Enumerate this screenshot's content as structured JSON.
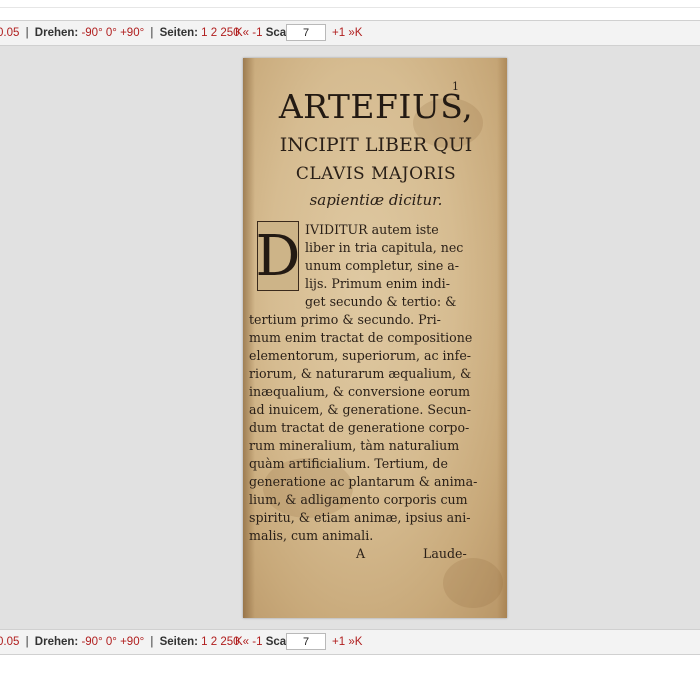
{
  "toolbar": {
    "zoom_value": "0.05",
    "sep": "|",
    "rotate_label": "Drehen:",
    "rotate_options": [
      "-90°",
      "0°",
      "+90°"
    ],
    "pages_label": "Seiten:",
    "pages_options": [
      "1",
      "2",
      "250"
    ],
    "first_icon": "first-page-icon",
    "first_glyph": "K«",
    "prev_label": "-1",
    "scan_label": "Scan",
    "scan_value": "7",
    "next_label": "+1",
    "last_icon": "last-page-icon",
    "last_glyph": "»K"
  },
  "page": {
    "page_number": "1",
    "title_line1": "ARTEFIUS,",
    "title_line2": "INCIPIT LIBER QUI",
    "title_line3": "CLAVIS MAJORIS",
    "title_line4": "sapientiæ dicitur.",
    "dropcap": "D",
    "body_lines": [
      "IVIDITUR autem iste",
      "liber in tria capitula, nec",
      "unum completur, sine a-",
      "lijs.  Primum enim indi-",
      "get secundo & tertio: &",
      "tertium primo & secundo.  Pri-",
      "mum enim tractat de compositione",
      "elementorum, superiorum, ac infe-",
      "riorum, & naturarum æqualium, &",
      "inæqualium, & conversione eorum",
      "ad inuicem, & generatione. Secun-",
      "dum tractat de generatione corpo-",
      "rum mineralium, tàm naturalium",
      "quàm artificialium.  Tertium, de",
      "generatione ac plantarum & anima-",
      "lium, & adligamento corporis cum",
      "spiritu, & etiam animæ, ipsius ani-",
      "malis, cum animali."
    ],
    "catch_a": "A",
    "catch_word": "Laude-"
  },
  "colors": {
    "link_red": "#b01e1e",
    "toolbar_bg": "#f3f3f3",
    "viewer_bg": "#e1e1e1",
    "paper": "#d6bc91"
  }
}
